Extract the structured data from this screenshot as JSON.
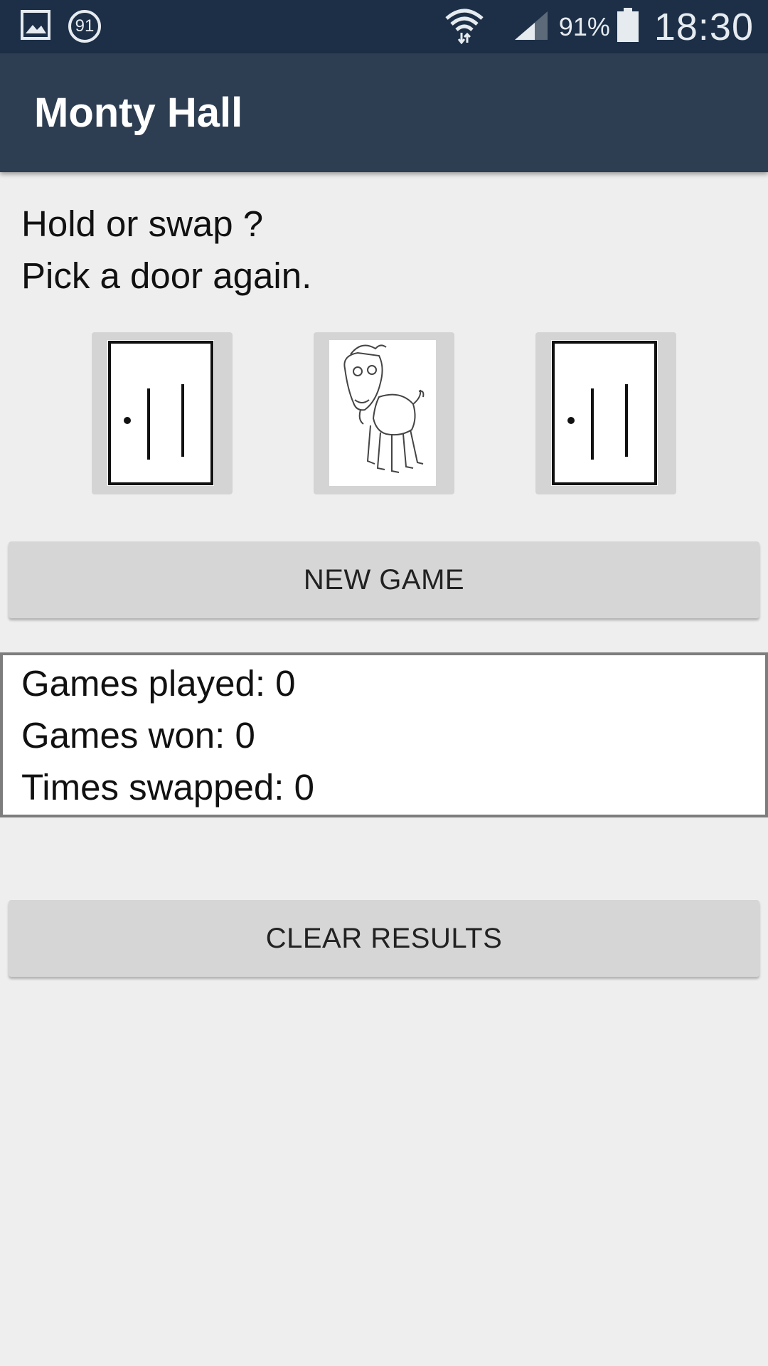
{
  "status_bar": {
    "battery_percent": "91%",
    "time": "18:30",
    "notification_badge": "91",
    "icons": [
      "gallery-icon",
      "data-usage-icon",
      "wifi-icon",
      "signal-icon",
      "battery-icon"
    ]
  },
  "app_bar": {
    "title": "Monty Hall"
  },
  "prompt": {
    "line1": "Hold or swap ?",
    "line2": "Pick a door again."
  },
  "doors": [
    {
      "state": "closed",
      "icon": "door-icon"
    },
    {
      "state": "open-goat",
      "icon": "goat-icon"
    },
    {
      "state": "closed",
      "icon": "door-icon"
    }
  ],
  "buttons": {
    "new_game": "NEW GAME",
    "clear_results": "CLEAR RESULTS"
  },
  "results": {
    "games_played": "Games played: 0",
    "games_won": "Games won: 0",
    "times_swapped": "Times swapped: 0"
  },
  "colors": {
    "status_bar": "#1c2f47",
    "app_bar": "#2e3e52",
    "background": "#eeeeee",
    "button": "#d6d6d6"
  }
}
